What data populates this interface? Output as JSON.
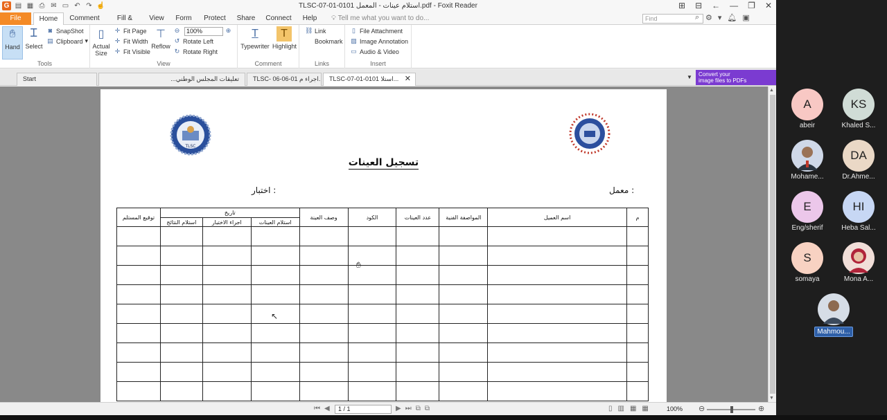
{
  "window": {
    "title": "TLSC-07-01-0101 استلام عينات - المعمل.pdf - Foxit Reader"
  },
  "menu": {
    "tabs": [
      "File",
      "Home",
      "Comment",
      "Fill & Sign",
      "View",
      "Form",
      "Protect",
      "Share",
      "Connect",
      "Help"
    ],
    "tell_me": "Tell me what you want to do...",
    "find_placeholder": "Find"
  },
  "ribbon": {
    "tools": {
      "hand": "Hand",
      "select": "Select",
      "snapshot": "SnapShot",
      "clipboard": "Clipboard",
      "label": "Tools"
    },
    "view": {
      "actual_size": "Actual Size",
      "fit_page": "Fit Page",
      "fit_width": "Fit Width",
      "fit_visible": "Fit Visible",
      "reflow": "Reflow",
      "zoom": "100%",
      "rotate_left": "Rotate Left",
      "rotate_right": "Rotate Right",
      "label": "View"
    },
    "comment": {
      "typewriter": "Typewriter",
      "highlight": "Highlight",
      "label": "Comment"
    },
    "links": {
      "link": "Link",
      "bookmark": "Bookmark",
      "label": "Links"
    },
    "insert": {
      "file_attachment": "File Attachment",
      "image_annotation": "Image Annotation",
      "audio_video": "Audio & Video",
      "label": "Insert"
    }
  },
  "doc_tabs": [
    {
      "label": "Start"
    },
    {
      "label": "تعليقات المجلس الوطني..."
    },
    {
      "label": "TLSC- 06-06-01 اجراء م..."
    },
    {
      "label": "TLSC-07-01-0101 استلا..."
    }
  ],
  "promo": {
    "line1": "Convert your",
    "line2": "image files to PDFs"
  },
  "document": {
    "title": "تسجيل العينات",
    "lab_label": "معمل :",
    "test_label": "اختبار :",
    "columns": {
      "serial": "م",
      "client_name": "اسم العميل",
      "specification": "المواصفة الفنية",
      "sample_count": "عدد العينات",
      "code": "الكود",
      "sample_description": "وصف العينة",
      "date_group": "تاريخ",
      "date_receipt": "استلام العينات",
      "date_test": "اجراء الاختبار",
      "date_results": "استلام النتائج",
      "receiver_signature": "توقيع المستلم"
    },
    "logo_left_text": "TLSC"
  },
  "statusbar": {
    "page": "1 / 1",
    "zoom": "100%"
  },
  "participants": [
    {
      "initials": "A",
      "name": "abeir",
      "color": "#f8c8c4"
    },
    {
      "initials": "KS",
      "name": "Khaled S...",
      "color": "#d0dcd6"
    },
    {
      "initials": "",
      "name": "Mohame...",
      "color": "#cfd8e8"
    },
    {
      "initials": "DA",
      "name": "Dr.Ahme...",
      "color": "#ead8c6"
    },
    {
      "initials": "E",
      "name": "Eng/sherif",
      "color": "#ecc7ea"
    },
    {
      "initials": "HI",
      "name": "Heba Sal...",
      "color": "#c7d7f4"
    },
    {
      "initials": "S",
      "name": "somaya",
      "color": "#f8d2c2"
    },
    {
      "initials": "",
      "name": "Mona A...",
      "color": "#f1ded8"
    },
    {
      "initials": "",
      "name": "Mahmou...",
      "color": "#d6dde6"
    }
  ]
}
